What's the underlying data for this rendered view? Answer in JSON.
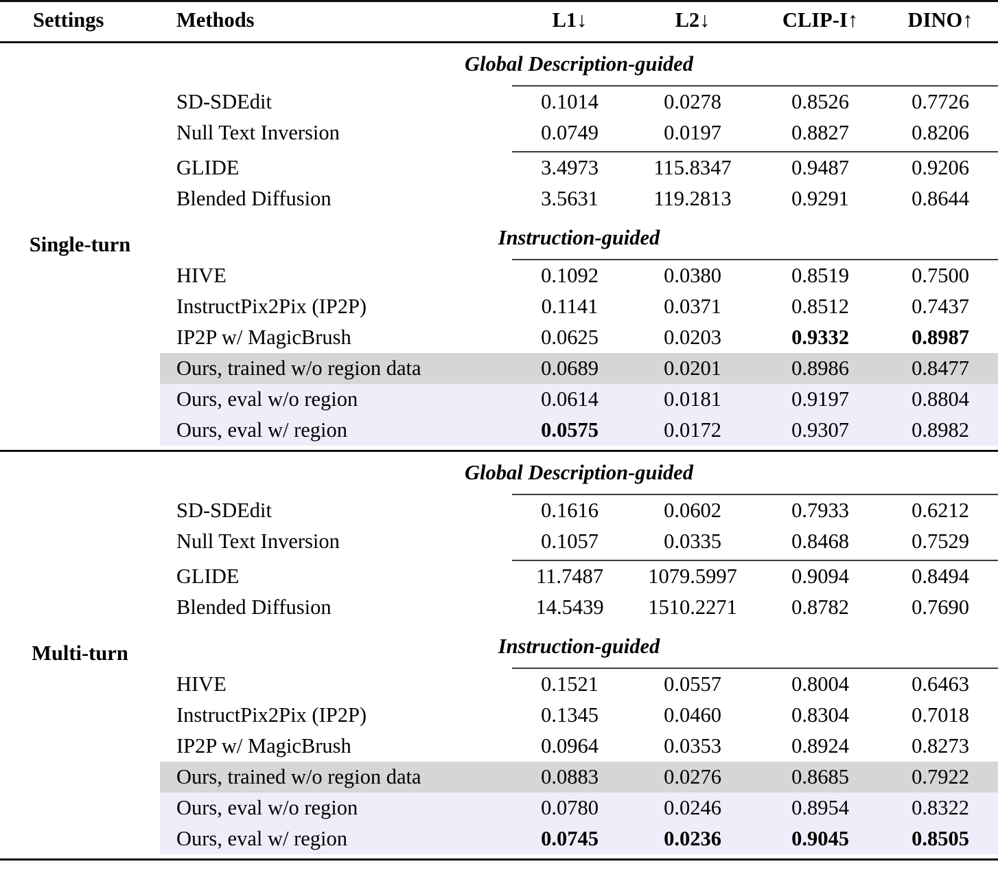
{
  "table": {
    "headers": {
      "settings": "Settings",
      "methods": "Methods",
      "l1": "L1↓",
      "l2": "L2↓",
      "clip_i": "CLIP-I↑",
      "dino": "DINO↑"
    },
    "group_labels": {
      "global": "Global Description-guided",
      "instruction": "Instruction-guided"
    },
    "settings": {
      "single_turn": "Single-turn",
      "multi_turn": "Multi-turn"
    },
    "highlight_colors": {
      "gray_row": "#d6d6d6",
      "lavender_row": "#eeeefa"
    },
    "sections": [
      {
        "setting": "Single-turn",
        "groups": [
          {
            "label": "Global Description-guided",
            "blocks": [
              {
                "rows": [
                  {
                    "method": "SD-SDEdit",
                    "l1": "0.1014",
                    "l2": "0.0278",
                    "clip_i": "0.8526",
                    "dino": "0.7726",
                    "bold": [],
                    "highlight": "none"
                  },
                  {
                    "method": "Null Text Inversion",
                    "l1": "0.0749",
                    "l2": "0.0197",
                    "clip_i": "0.8827",
                    "dino": "0.8206",
                    "bold": [],
                    "highlight": "none"
                  }
                ]
              },
              {
                "rows": [
                  {
                    "method": "GLIDE",
                    "l1": "3.4973",
                    "l2": "115.8347",
                    "clip_i": "0.9487",
                    "dino": "0.9206",
                    "bold": [],
                    "highlight": "none"
                  },
                  {
                    "method": "Blended Diffusion",
                    "l1": "3.5631",
                    "l2": "119.2813",
                    "clip_i": "0.9291",
                    "dino": "0.8644",
                    "bold": [],
                    "highlight": "none"
                  }
                ]
              }
            ]
          },
          {
            "label": "Instruction-guided",
            "blocks": [
              {
                "rows": [
                  {
                    "method": "HIVE",
                    "l1": "0.1092",
                    "l2": "0.0380",
                    "clip_i": "0.8519",
                    "dino": "0.7500",
                    "bold": [],
                    "highlight": "none"
                  },
                  {
                    "method": "InstructPix2Pix (IP2P)",
                    "l1": "0.1141",
                    "l2": "0.0371",
                    "clip_i": "0.8512",
                    "dino": "0.7437",
                    "bold": [],
                    "highlight": "none"
                  },
                  {
                    "method": "IP2P w/ MagicBrush",
                    "l1": "0.0625",
                    "l2": "0.0203",
                    "clip_i": "0.9332",
                    "dino": "0.8987",
                    "bold": [
                      "clip_i",
                      "dino"
                    ],
                    "highlight": "none"
                  },
                  {
                    "method": "Ours, trained w/o region data",
                    "l1": "0.0689",
                    "l2": "0.0201",
                    "clip_i": "0.8986",
                    "dino": "0.8477",
                    "bold": [],
                    "highlight": "gray"
                  },
                  {
                    "method": "Ours, eval w/o region",
                    "l1": "0.0614",
                    "l2": "0.0181",
                    "clip_i": "0.9197",
                    "dino": "0.8804",
                    "bold": [],
                    "highlight": "lavender"
                  },
                  {
                    "method": "Ours, eval w/ region",
                    "l1": "0.0575",
                    "l2": "0.0172",
                    "clip_i": "0.9307",
                    "dino": "0.8982",
                    "bold": [
                      "l1"
                    ],
                    "highlight": "lavender"
                  }
                ]
              }
            ]
          }
        ]
      },
      {
        "setting": "Multi-turn",
        "groups": [
          {
            "label": "Global Description-guided",
            "blocks": [
              {
                "rows": [
                  {
                    "method": "SD-SDEdit",
                    "l1": "0.1616",
                    "l2": "0.0602",
                    "clip_i": "0.7933",
                    "dino": "0.6212",
                    "bold": [],
                    "highlight": "none"
                  },
                  {
                    "method": "Null Text Inversion",
                    "l1": "0.1057",
                    "l2": "0.0335",
                    "clip_i": "0.8468",
                    "dino": "0.7529",
                    "bold": [],
                    "highlight": "none"
                  }
                ]
              },
              {
                "rows": [
                  {
                    "method": "GLIDE",
                    "l1": "11.7487",
                    "l2": "1079.5997",
                    "clip_i": "0.9094",
                    "dino": "0.8494",
                    "bold": [],
                    "highlight": "none"
                  },
                  {
                    "method": "Blended Diffusion",
                    "l1": "14.5439",
                    "l2": "1510.2271",
                    "clip_i": "0.8782",
                    "dino": "0.7690",
                    "bold": [],
                    "highlight": "none"
                  }
                ]
              }
            ]
          },
          {
            "label": "Instruction-guided",
            "blocks": [
              {
                "rows": [
                  {
                    "method": "HIVE",
                    "l1": "0.1521",
                    "l2": "0.0557",
                    "clip_i": "0.8004",
                    "dino": "0.6463",
                    "bold": [],
                    "highlight": "none"
                  },
                  {
                    "method": "InstructPix2Pix (IP2P)",
                    "l1": "0.1345",
                    "l2": "0.0460",
                    "clip_i": "0.8304",
                    "dino": "0.7018",
                    "bold": [],
                    "highlight": "none"
                  },
                  {
                    "method": "IP2P w/ MagicBrush",
                    "l1": "0.0964",
                    "l2": "0.0353",
                    "clip_i": "0.8924",
                    "dino": "0.8273",
                    "bold": [],
                    "highlight": "none"
                  },
                  {
                    "method": "Ours, trained w/o region data",
                    "l1": "0.0883",
                    "l2": "0.0276",
                    "clip_i": "0.8685",
                    "dino": "0.7922",
                    "bold": [],
                    "highlight": "gray"
                  },
                  {
                    "method": "Ours, eval w/o region",
                    "l1": "0.0780",
                    "l2": "0.0246",
                    "clip_i": "0.8954",
                    "dino": "0.8322",
                    "bold": [],
                    "highlight": "lavender"
                  },
                  {
                    "method": "Ours, eval w/ region",
                    "l1": "0.0745",
                    "l2": "0.0236",
                    "clip_i": "0.9045",
                    "dino": "0.8505",
                    "bold": [
                      "l1",
                      "l2",
                      "clip_i",
                      "dino"
                    ],
                    "highlight": "lavender"
                  }
                ]
              }
            ]
          }
        ]
      }
    ]
  }
}
